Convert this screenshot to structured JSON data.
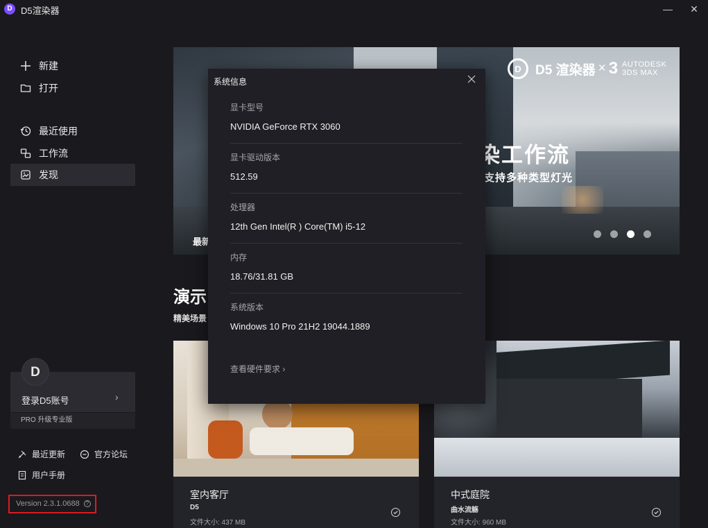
{
  "window": {
    "title": "D5渲染器",
    "logo_letter": "D",
    "minimize_glyph": "—",
    "close_glyph": "✕"
  },
  "sidebar": {
    "items": [
      {
        "label": "新建",
        "icon": "plus-icon"
      },
      {
        "label": "打开",
        "icon": "folder-icon"
      },
      {
        "label": "最近使用",
        "icon": "history-icon"
      },
      {
        "label": "工作流",
        "icon": "workflow-icon"
      },
      {
        "label": "发现",
        "icon": "discover-icon",
        "active": true
      }
    ],
    "account": {
      "avatar_letter": "D",
      "login_label": "登录D5账号",
      "pro_label": "PRO 升级专业版"
    },
    "links": {
      "updates": "最近更新",
      "forum": "官方论坛",
      "manual": "用户手册"
    },
    "version": "Version 2.3.1.0688"
  },
  "banner": {
    "brand_logo": "D",
    "brand_name": "D5 渲染器",
    "brand_x": "×",
    "brand_three": "3",
    "brand_autodesk_line1": "AUTODESK",
    "brand_autodesk_line2": "3DS MAX",
    "headline": "染工作流",
    "subline": "支持多种类型灯光",
    "left_text": "最新",
    "slide_count": 4,
    "active_slide": 3
  },
  "section": {
    "title": "演示",
    "subtitle": "精美场景"
  },
  "cards": [
    {
      "title": "室内客厅",
      "author": "D5",
      "size": "文件大小: 437 MB"
    },
    {
      "title": "中式庭院",
      "author": "曲水流觞",
      "size": "文件大小: 960 MB"
    }
  ],
  "dialog": {
    "title": "系统信息",
    "rows": [
      {
        "label": "显卡型号",
        "value": "NVIDIA GeForce RTX 3060"
      },
      {
        "label": "显卡驱动版本",
        "value": "512.59"
      },
      {
        "label": "处理器",
        "value": "12th Gen Intel(R ) Core(TM) i5-12"
      },
      {
        "label": "内存",
        "value": "18.76/31.81 GB"
      },
      {
        "label": "系统版本",
        "value": "Windows 10 Pro 21H2 19044.1889"
      }
    ],
    "hardware_link": "查看硬件要求 ›"
  },
  "colors": {
    "background": "#1a1a1e",
    "panel": "#2b2b31",
    "dialog": "#1f1f25",
    "accent_logo": "#7b4dff",
    "highlight_border": "#e0191f"
  }
}
